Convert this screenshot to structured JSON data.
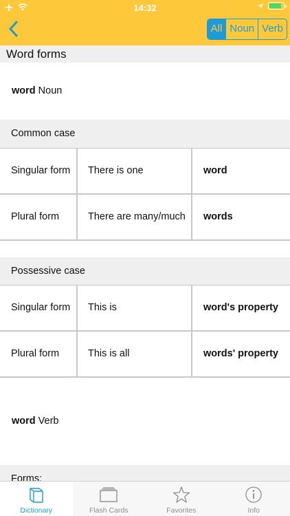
{
  "status": {
    "time": "14:32"
  },
  "nav": {
    "segments": [
      {
        "label": "All",
        "active": true
      },
      {
        "label": "Noun",
        "active": false
      },
      {
        "label": "Verb",
        "active": false
      }
    ]
  },
  "content": {
    "title": "Word forms",
    "noun": {
      "word": "word",
      "pos": "Noun"
    },
    "common_case": {
      "header": "Common case",
      "rows": [
        {
          "form": "Singular form",
          "meaning": "There is one",
          "value": "word"
        },
        {
          "form": "Plural form",
          "meaning": "There are many/much",
          "value": "words"
        }
      ]
    },
    "possessive_case": {
      "header": "Possessive case",
      "rows": [
        {
          "form": "Singular form",
          "meaning": "This is",
          "value": "word's property"
        },
        {
          "form": "Plural form",
          "meaning": "This is all",
          "value": "words' property"
        }
      ]
    },
    "verb": {
      "word": "word",
      "pos": "Verb"
    },
    "forms_header": "Forms:"
  },
  "tabbar": {
    "tabs": [
      {
        "label": "Dictionary",
        "icon": "book-icon",
        "active": true
      },
      {
        "label": "Flash Cards",
        "icon": "cards-icon",
        "active": false
      },
      {
        "label": "Favorites",
        "icon": "star-icon",
        "active": false
      },
      {
        "label": "Info",
        "icon": "info-icon",
        "active": false
      }
    ]
  },
  "colors": {
    "bar": "#fdc93a",
    "accent": "#1e9bd7",
    "battery": "#4cd964"
  }
}
